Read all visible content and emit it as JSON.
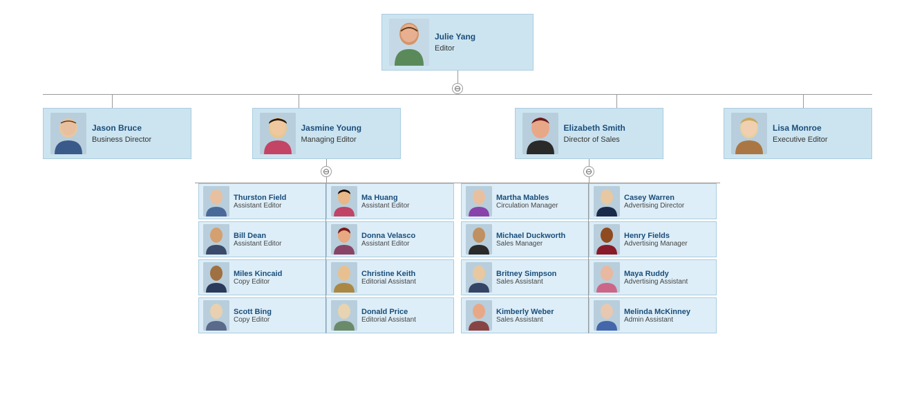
{
  "org": {
    "root": {
      "name": "Julie Yang",
      "title": "Editor",
      "avatarColor": "#c5d8e5",
      "gender": "f"
    },
    "level1": [
      {
        "name": "Jason Bruce",
        "title": "Business Director",
        "gender": "m",
        "hasChildren": false
      },
      {
        "name": "Jasmine Young",
        "title": "Managing Editor",
        "gender": "f",
        "hasChildren": true,
        "toggle": "⊖",
        "children": [
          {
            "col": 0,
            "name": "Thurston Field",
            "title": "Assistant Editor",
            "gender": "m"
          },
          {
            "col": 0,
            "name": "Bill Dean",
            "title": "Assistant Editor",
            "gender": "m"
          },
          {
            "col": 0,
            "name": "Miles Kincaid",
            "title": "Copy Editor",
            "gender": "m"
          },
          {
            "col": 0,
            "name": "Scott Bing",
            "title": "Copy Editor",
            "gender": "m"
          },
          {
            "col": 1,
            "name": "Ma Huang",
            "title": "Assistant Editor",
            "gender": "f"
          },
          {
            "col": 1,
            "name": "Donna Velasco",
            "title": "Assistant Editor",
            "gender": "f"
          },
          {
            "col": 1,
            "name": "Christine Keith",
            "title": "Editorial Assistant",
            "gender": "f"
          },
          {
            "col": 1,
            "name": "Donald Price",
            "title": "Editorial Assistant",
            "gender": "m"
          }
        ]
      },
      {
        "name": "Elizabeth Smith",
        "title": "Director of Sales",
        "gender": "f",
        "hasChildren": true,
        "toggle": "⊖",
        "children": [
          {
            "col": 0,
            "name": "Martha Mables",
            "title": "Circulation Manager",
            "gender": "f"
          },
          {
            "col": 0,
            "name": "Michael Duckworth",
            "title": "Sales Manager",
            "gender": "m"
          },
          {
            "col": 0,
            "name": "Britney Simpson",
            "title": "Sales Assistant",
            "gender": "f"
          },
          {
            "col": 0,
            "name": "Kimberly Weber",
            "title": "Sales Assistant",
            "gender": "f"
          },
          {
            "col": 1,
            "name": "Casey Warren",
            "title": "Advertising Director",
            "gender": "m"
          },
          {
            "col": 1,
            "name": "Henry Fields",
            "title": "Advertising Manager",
            "gender": "m"
          },
          {
            "col": 1,
            "name": "Maya Ruddy",
            "title": "Advertising Assistant",
            "gender": "f"
          },
          {
            "col": 1,
            "name": "Melinda McKinney",
            "title": "Admin Assistant",
            "gender": "f"
          }
        ]
      },
      {
        "name": "Lisa Monroe",
        "title": "Executive Editor",
        "gender": "f",
        "hasChildren": false
      }
    ],
    "toggle_label": "⊖"
  }
}
